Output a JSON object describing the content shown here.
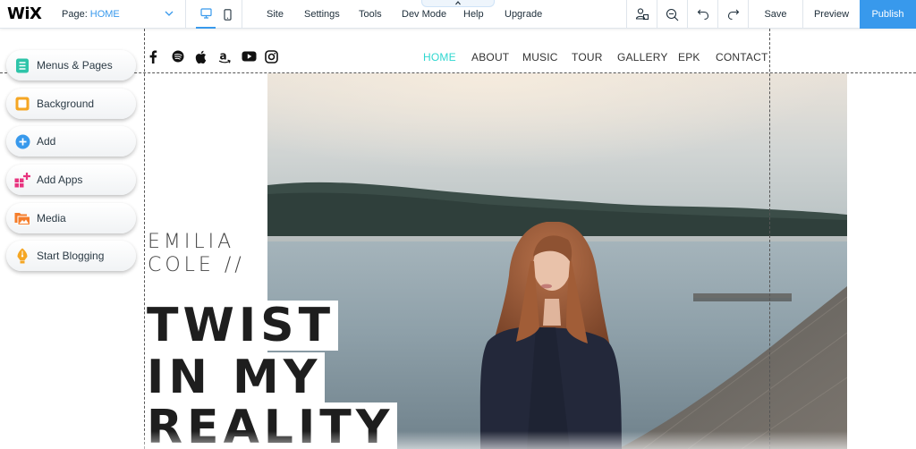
{
  "toolbar": {
    "logo": "WiX",
    "page_label": "Page:",
    "page_value": "HOME",
    "menus": [
      "Site",
      "Settings",
      "Tools",
      "Dev Mode",
      "Help",
      "Upgrade"
    ],
    "save_label": "Save",
    "preview_label": "Preview",
    "publish_label": "Publish",
    "icons": [
      "desktop-icon",
      "mobile-icon",
      "people-icon",
      "zoom-out-icon",
      "undo-icon",
      "redo-icon",
      "chevron-up-icon",
      "chevron-down-icon"
    ],
    "accent_color": "#3899ec"
  },
  "panel": {
    "items": [
      {
        "label": "Menus & Pages",
        "icon": "pages-icon",
        "color": "#2ec4a9"
      },
      {
        "label": "Background",
        "icon": "background-icon",
        "color": "#f5a623"
      },
      {
        "label": "Add",
        "icon": "plus-circle-icon",
        "color": "#3899ec"
      },
      {
        "label": "Add Apps",
        "icon": "apps-icon",
        "color": "#e8347f"
      },
      {
        "label": "Media",
        "icon": "media-icon",
        "color": "#f57d2a"
      },
      {
        "label": "Start Blogging",
        "icon": "pen-nib-icon",
        "color": "#f5a623"
      }
    ]
  },
  "site": {
    "social_icons": [
      "facebook-icon",
      "spotify-icon",
      "apple-icon",
      "amazon-icon",
      "youtube-icon",
      "instagram-icon"
    ],
    "nav": [
      {
        "label": "HOME",
        "active": true
      },
      {
        "label": "ABOUT",
        "active": false
      },
      {
        "label": "MUSIC",
        "active": false
      },
      {
        "label": "TOUR",
        "active": false
      },
      {
        "label": "GALLERY",
        "active": false
      },
      {
        "label": "EPK",
        "active": false
      },
      {
        "label": "CONTACT",
        "active": false
      }
    ],
    "nav_active_color": "#2fd7d0",
    "name_line1": "EMILIA",
    "name_line2": "COLE //",
    "headline": [
      "TWIST",
      "IN MY",
      "REALITY"
    ],
    "hero_image": "woman-by-lake-photo"
  }
}
